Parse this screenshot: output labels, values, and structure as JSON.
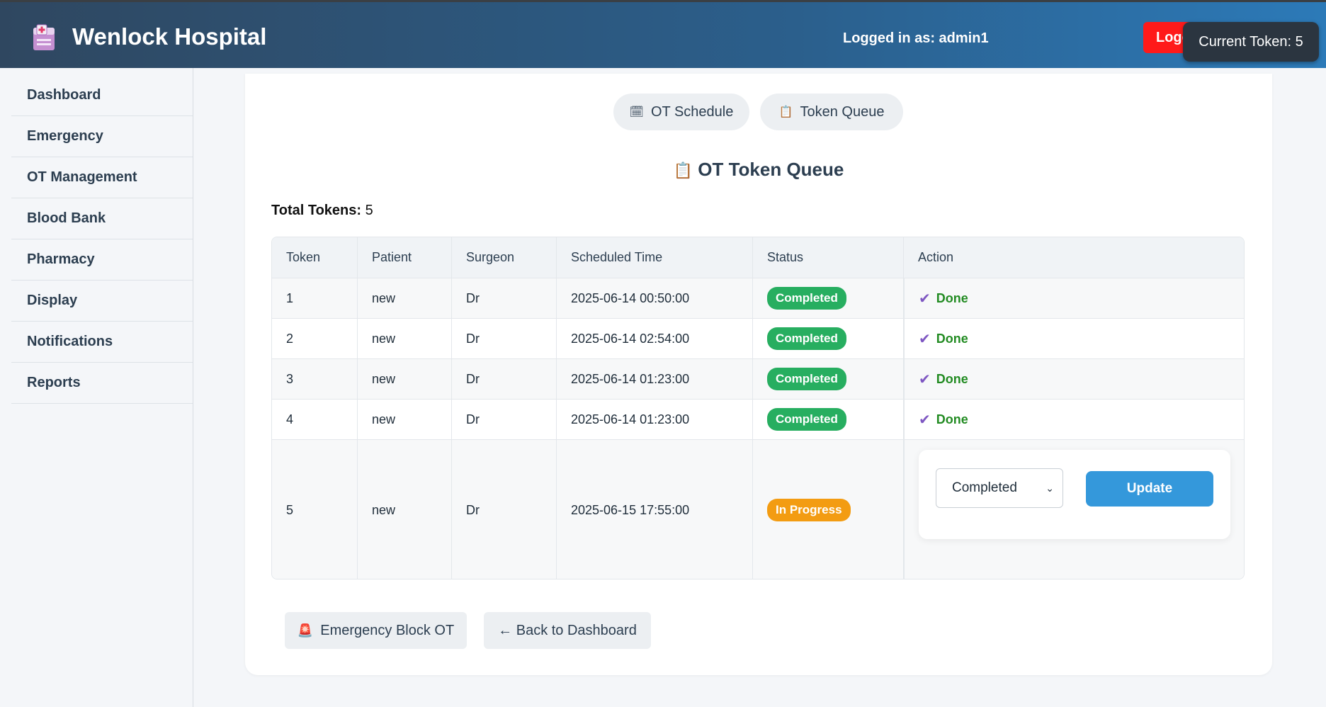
{
  "header": {
    "brand": "Wenlock Hospital",
    "user_label": "Logged in as: admin1",
    "logout_label": "Logout",
    "current_token": "Current Token: 5",
    "logo_icon": "hospital-icon"
  },
  "sidebar": {
    "items": [
      {
        "label": "Dashboard"
      },
      {
        "label": "Emergency"
      },
      {
        "label": "OT Management"
      },
      {
        "label": "Blood Bank"
      },
      {
        "label": "Pharmacy"
      },
      {
        "label": "Display"
      },
      {
        "label": "Notifications"
      },
      {
        "label": "Reports"
      }
    ]
  },
  "tabs": [
    {
      "label": "OT Schedule",
      "icon": "calendar-icon"
    },
    {
      "label": "Token Queue",
      "icon": "clipboard-icon"
    }
  ],
  "queue": {
    "title": "OT Token Queue",
    "title_icon": "clipboard-icon",
    "total_label": "Total Tokens:",
    "total_value": "5"
  },
  "table": {
    "headers": [
      "Token",
      "Patient",
      "Surgeon",
      "Scheduled Time",
      "Status",
      "Action"
    ],
    "rows": [
      {
        "token": "1",
        "patient": "new",
        "surgeon": "Dr",
        "time": "2025-06-14 00:50:00",
        "status": "Completed",
        "action": "Done"
      },
      {
        "token": "2",
        "patient": "new",
        "surgeon": "Dr",
        "time": "2025-06-14 02:54:00",
        "status": "Completed",
        "action": "Done"
      },
      {
        "token": "3",
        "patient": "new",
        "surgeon": "Dr",
        "time": "2025-06-14 01:23:00",
        "status": "Completed",
        "action": "Done"
      },
      {
        "token": "4",
        "patient": "new",
        "surgeon": "Dr",
        "time": "2025-06-14 01:23:00",
        "status": "Completed",
        "action": "Done"
      },
      {
        "token": "5",
        "patient": "new",
        "surgeon": "Dr",
        "time": "2025-06-15 17:55:00",
        "status": "In Progress",
        "select_value": "Completed",
        "update_label": "Update"
      }
    ]
  },
  "colors": {
    "completed": "#27ae60",
    "in_progress": "#f39c12",
    "update": "#3498db",
    "logout": "#ff1a1a"
  },
  "bottom": {
    "emergency_label": "Emergency Block OT",
    "emergency_icon": "siren-icon",
    "back_label": "← Back to Dashboard"
  }
}
